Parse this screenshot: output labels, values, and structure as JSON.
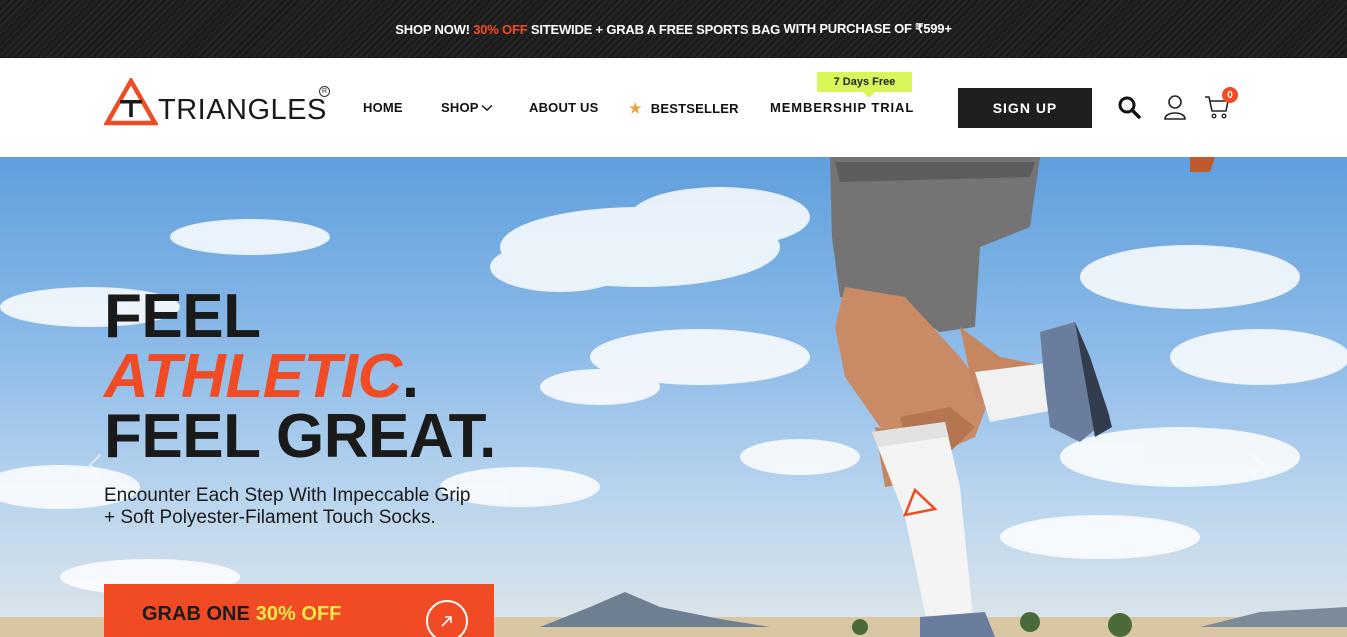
{
  "announcement": {
    "part1": "SHOP NOW! ",
    "accent": "30% OFF",
    "part2": " SITEWIDE + GRAB A FREE SPORTS ",
    "bold": "BAG",
    "part3": " WITH PURCHASE OF ₹599+"
  },
  "header": {
    "logo_text": "TRIANGLES",
    "logo_reg": "R",
    "nav": {
      "home": "HOME",
      "shop": "SHOP",
      "about": "ABOUT US",
      "bestseller": "BESTSELLER",
      "membership": "MEMBERSHIP TRIAL"
    },
    "trial_badge": "7 Days Free",
    "signup": "SIGN UP",
    "cart_count": "0"
  },
  "hero": {
    "line1": "FEEL",
    "line2": "ATHLETIC",
    "line2_dot": ".",
    "line3": "FEEL GREAT.",
    "subtext": "Encounter Each Step With Impeccable Grip + Soft Polyester-Filament Touch Socks.",
    "cta_text": "GRAB ONE",
    "cta_highlight": "30% OFF"
  },
  "colors": {
    "brand_orange": "#f04b24",
    "badge_green": "#d8f55a",
    "dark": "#1f1f1f",
    "highlight_yellow": "#f5e94b"
  },
  "icons": [
    "search-icon",
    "user-icon",
    "cart-icon",
    "star-icon",
    "chevron-down-icon",
    "arrow-up-right-icon",
    "chevron-left-icon",
    "chevron-right-icon"
  ]
}
